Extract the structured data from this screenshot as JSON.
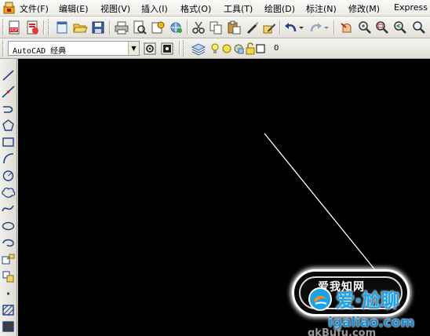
{
  "menubar": {
    "items": [
      "文件(F)",
      "编辑(E)",
      "视图(V)",
      "插入(I)",
      "格式(O)",
      "工具(T)",
      "绘图(D)",
      "标注(N)",
      "修改(M)",
      "Express"
    ]
  },
  "toolbar": {
    "icons": [
      "pdf-icon",
      "pdf-publish-icon",
      "new-icon",
      "open-icon",
      "save-icon",
      "print-icon",
      "print-preview-icon",
      "publish-icon",
      "plot-icon",
      "cut-icon",
      "copy-icon",
      "paste-icon",
      "match-properties-icon",
      "block-editor-icon",
      "undo-icon",
      "redo-icon",
      "pan-icon",
      "zoom-realtime-icon",
      "zoom-window-icon",
      "zoom-previous-icon"
    ]
  },
  "workspace": {
    "value": "AutoCAD 经典"
  },
  "layer": {
    "name": "0"
  },
  "watermark": {
    "badge_text": "爱我知网",
    "brand": "爱·尬聊",
    "domain": "igaliao.com",
    "domain2": "qkBufu.com"
  },
  "colors": {
    "canvas": "#000000",
    "line": "#ffffff",
    "brand": "#1aa3e8"
  }
}
